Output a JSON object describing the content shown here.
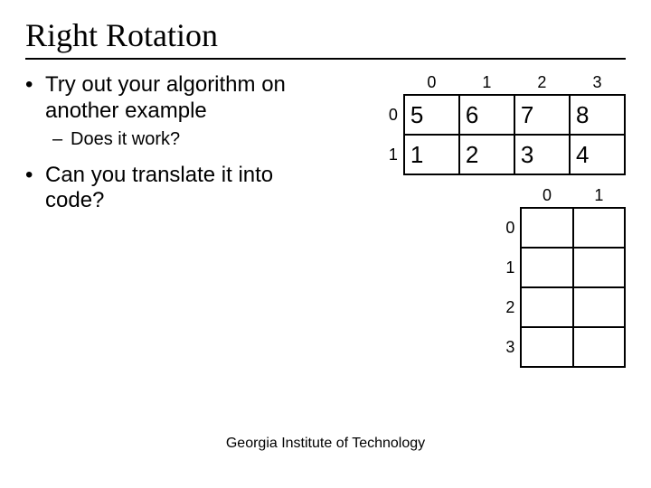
{
  "title": "Right Rotation",
  "bullets": {
    "b1": "Try out your algorithm on another example",
    "b1a": "Does it work?",
    "b2": "Can you translate it into code?"
  },
  "top_grid": {
    "col_headers": [
      "0",
      "1",
      "2",
      "3"
    ],
    "row_headers": [
      "0",
      "1"
    ],
    "rows": [
      [
        "5",
        "6",
        "7",
        "8"
      ],
      [
        "1",
        "2",
        "3",
        "4"
      ]
    ]
  },
  "bottom_grid": {
    "col_headers": [
      "0",
      "1"
    ],
    "row_headers": [
      "0",
      "1",
      "2",
      "3"
    ],
    "rows": [
      [
        "",
        ""
      ],
      [
        "",
        ""
      ],
      [
        "",
        ""
      ],
      [
        "",
        ""
      ]
    ]
  },
  "footer": "Georgia Institute of Technology"
}
